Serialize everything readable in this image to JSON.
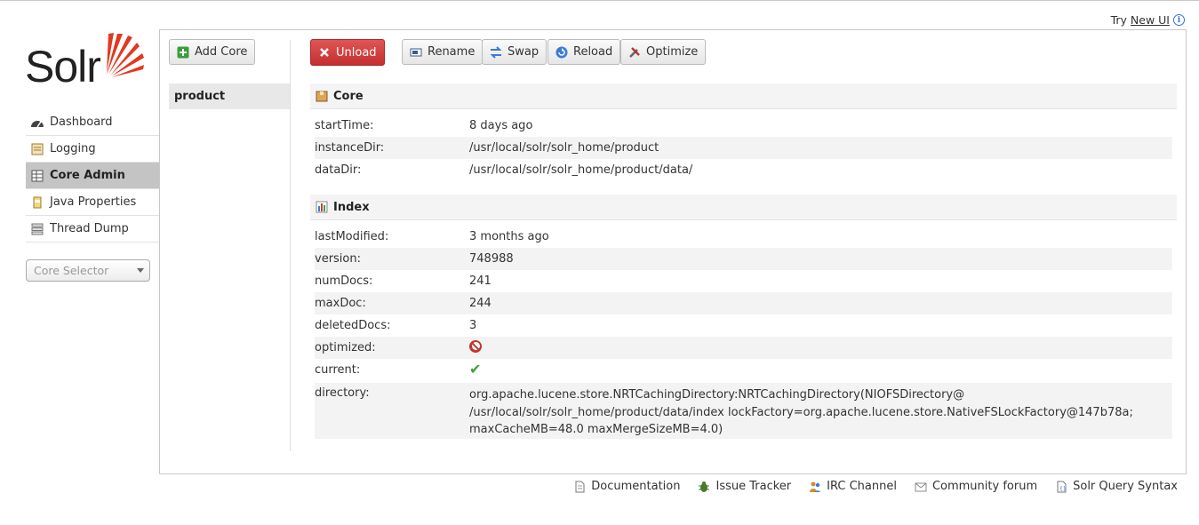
{
  "header": {
    "try_prefix": "Try",
    "try_link": "New UI"
  },
  "logo": {
    "text": "Solr"
  },
  "nav": {
    "items": [
      {
        "label": "Dashboard",
        "icon": "dashboard-icon"
      },
      {
        "label": "Logging",
        "icon": "logging-icon"
      },
      {
        "label": "Core Admin",
        "icon": "core-admin-icon",
        "active": true
      },
      {
        "label": "Java Properties",
        "icon": "java-properties-icon"
      },
      {
        "label": "Thread Dump",
        "icon": "thread-dump-icon"
      }
    ]
  },
  "core_selector": {
    "placeholder": "Core Selector"
  },
  "toolbar": {
    "add_core": "Add Core",
    "unload": "Unload",
    "rename": "Rename",
    "swap": "Swap",
    "reload": "Reload",
    "optimize": "Optimize"
  },
  "core_list": [
    "product"
  ],
  "core_section": {
    "title": "Core",
    "rows": [
      {
        "key": "startTime:",
        "value": "8 days ago"
      },
      {
        "key": "instanceDir:",
        "value": "/usr/local/solr/solr_home/product"
      },
      {
        "key": "dataDir:",
        "value": "/usr/local/solr/solr_home/product/data/"
      }
    ]
  },
  "index_section": {
    "title": "Index",
    "rows": [
      {
        "key": "lastModified:",
        "value": "3 months ago"
      },
      {
        "key": "version:",
        "value": "748988"
      },
      {
        "key": "numDocs:",
        "value": "241"
      },
      {
        "key": "maxDoc:",
        "value": "244"
      },
      {
        "key": "deletedDocs:",
        "value": "3"
      },
      {
        "key": "optimized:",
        "value_icon": "no-icon"
      },
      {
        "key": "current:",
        "value_icon": "check-icon"
      },
      {
        "key": "directory:",
        "value_lines": [
          "org.apache.lucene.store.NRTCachingDirectory:NRTCachingDirectory(NIOFSDirectory@",
          "/usr/local/solr/solr_home/product/data/index lockFactory=org.apache.lucene.store.NativeFSLockFactory@147b78a;",
          "maxCacheMB=48.0 maxMergeSizeMB=4.0)"
        ]
      }
    ]
  },
  "footer": {
    "links": [
      "Documentation",
      "Issue Tracker",
      "IRC Channel",
      "Community forum",
      "Solr Query Syntax"
    ]
  },
  "colors": {
    "unload_button": "#d03a3a",
    "active_nav": "#c4c4c4",
    "logo_accent": "#e2381f",
    "check": "#3aa335",
    "no": "#c0392b"
  }
}
